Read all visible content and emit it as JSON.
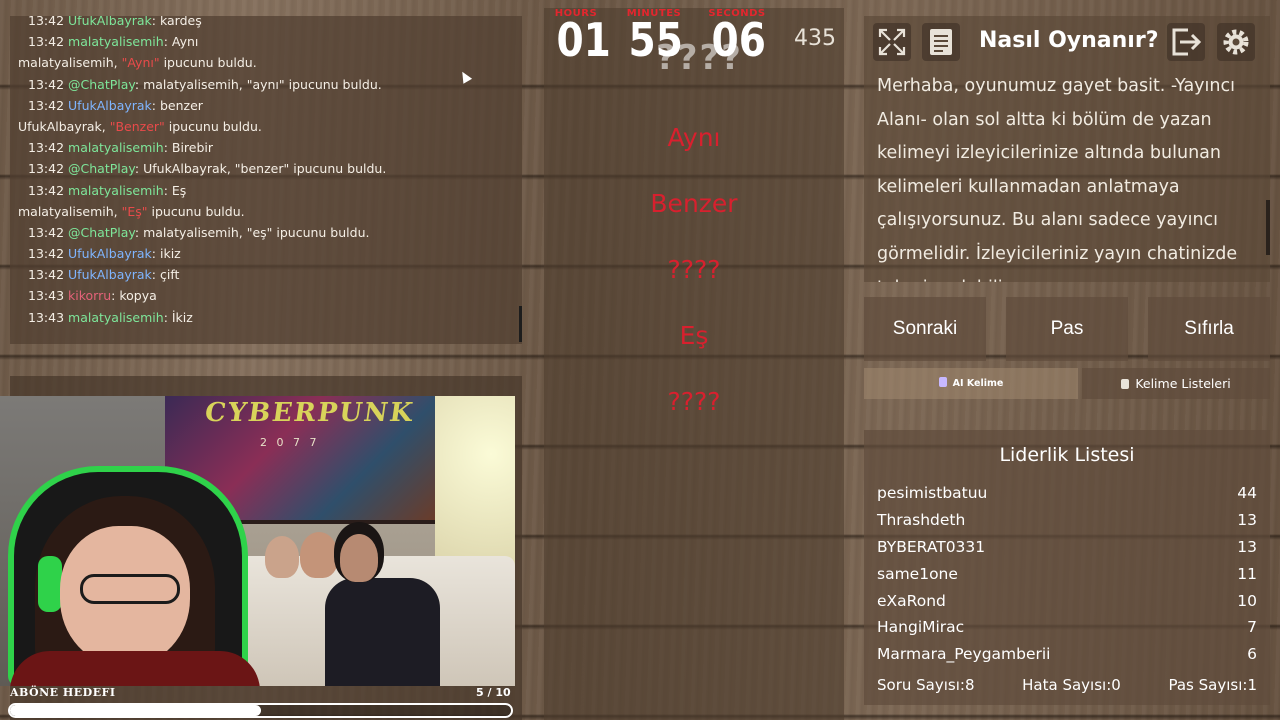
{
  "chat": {
    "messages": [
      {
        "time": "13:42",
        "user": "UfukAlbayrak",
        "user_color": "u-green",
        "text": "kardeş"
      },
      {
        "time": "13:42",
        "user": "malatyalisemih",
        "user_color": "u-green",
        "text": "Aynı"
      },
      {
        "system": true,
        "pre": "malatyalisemih, ",
        "hint": "\"Aynı\"",
        "post": " ipucunu buldu."
      },
      {
        "time": "13:42",
        "user": "@ChatPlay",
        "user_color": "u-green",
        "text": "malatyalisemih, \"aynı\" ipucunu buldu."
      },
      {
        "time": "13:42",
        "user": "UfukAlbayrak",
        "user_color": "u-blue",
        "text": "benzer"
      },
      {
        "system": true,
        "pre": "UfukAlbayrak, ",
        "hint": "\"Benzer\"",
        "post": " ipucunu buldu."
      },
      {
        "time": "13:42",
        "user": "malatyalisemih",
        "user_color": "u-green",
        "text": "Birebir"
      },
      {
        "time": "13:42",
        "user": "@ChatPlay",
        "user_color": "u-green",
        "text": "UfukAlbayrak, \"benzer\" ipucunu buldu."
      },
      {
        "time": "13:42",
        "user": "malatyalisemih",
        "user_color": "u-green",
        "text": "Eş"
      },
      {
        "system": true,
        "pre": "malatyalisemih, ",
        "hint": "\"Eş\"",
        "post": " ipucunu buldu."
      },
      {
        "time": "13:42",
        "user": "@ChatPlay",
        "user_color": "u-green",
        "text": "malatyalisemih, \"eş\" ipucunu buldu."
      },
      {
        "time": "13:42",
        "user": "UfukAlbayrak",
        "user_color": "u-blue",
        "text": "ikiz"
      },
      {
        "time": "13:42",
        "user": "UfukAlbayrak",
        "user_color": "u-blue",
        "text": "çift"
      },
      {
        "time": "13:43",
        "user": "kikorru",
        "user_color": "u-pink",
        "text": "kopya"
      },
      {
        "time": "13:43",
        "user": "malatyalisemih",
        "user_color": "u-green",
        "text": "İkiz"
      }
    ]
  },
  "webcam": {
    "poster_title": "CYBERPUNK",
    "poster_sub": "2 0 7 7"
  },
  "sub_goal": {
    "label": "ABÖNE HEDEFI",
    "count": "5  / 10",
    "progress": 0.5
  },
  "timer": {
    "hours_label": "HOURS",
    "hours": "01",
    "minutes_label": "MINUTES",
    "minutes": "55",
    "seconds_label": "SECONDS",
    "seconds": "06",
    "ghost": "????",
    "score": "435"
  },
  "words": [
    "Aynı",
    "Benzer",
    "????",
    "Eş",
    "????"
  ],
  "howto": {
    "title": "Nasıl Oynanır?",
    "text": "Merhaba, oyunumuz gayet basit. -Yayıncı Alanı- olan sol altta ki bölüm de yazan kelimeyi izleyicilerinize altında bulunan kelimeleri kullanmadan anlatmaya çalışıyorsunuz. Bu alanı sadece yayıncı görmelidir. İzleyicileriniz yayın chatinizde tahmin edebilir."
  },
  "actions": {
    "next": "Sonraki",
    "pass": "Pas",
    "reset": "Sıfırla",
    "ai": "AI Kelime",
    "lists": "Kelime Listeleri"
  },
  "leaderboard": {
    "title": "Liderlik Listesi",
    "entries": [
      {
        "name": "pesimistbatuu",
        "score": "44"
      },
      {
        "name": "Thrashdeth",
        "score": "13"
      },
      {
        "name": "BYBERAT0331",
        "score": "13"
      },
      {
        "name": "same1one",
        "score": "11"
      },
      {
        "name": "eXaRond",
        "score": "10"
      },
      {
        "name": "HangiMirac",
        "score": "7"
      },
      {
        "name": "Marmara_Peygamberii",
        "score": "6"
      }
    ],
    "stats": {
      "questions_label": "Soru Sayısı:",
      "questions": "8",
      "errors_label": "Hata Sayısı:",
      "errors": "0",
      "passes_label": "Pas Sayısı:",
      "passes": "1"
    }
  },
  "colors": {
    "accent_red": "#d8202e",
    "chat_green": "#7ee69a",
    "chat_blue": "#7fb5ff",
    "chat_pink": "#e36278",
    "system_blue": "#58a9ff"
  }
}
